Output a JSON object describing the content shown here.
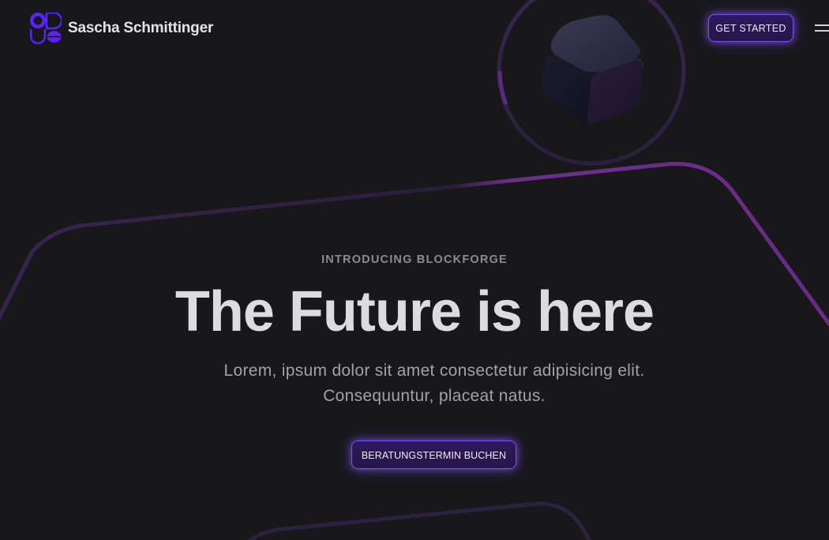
{
  "header": {
    "brand_name": "Sascha Schmittinger",
    "logo_icon": "brand-logo-icon",
    "cta_label": "GET STARTED",
    "menu_icon": "hamburger-menu-icon"
  },
  "hero": {
    "eyebrow": "INTRODUCING BLOCKFORGE",
    "title": "The Future is here",
    "subtitle": "Lorem, ipsum dolor sit amet consectetur adipisicing elit. Consequuntur, placeat natus.",
    "cta_label": "BERATUNGSTERMIN BUCHEN",
    "image_icon": "cube-3d-icon"
  },
  "colors": {
    "background": "#18181b",
    "accent": "#7c4dff",
    "decor_line": "#6d28d9",
    "text_primary": "#dcdce0",
    "text_muted": "#a1a1aa"
  }
}
